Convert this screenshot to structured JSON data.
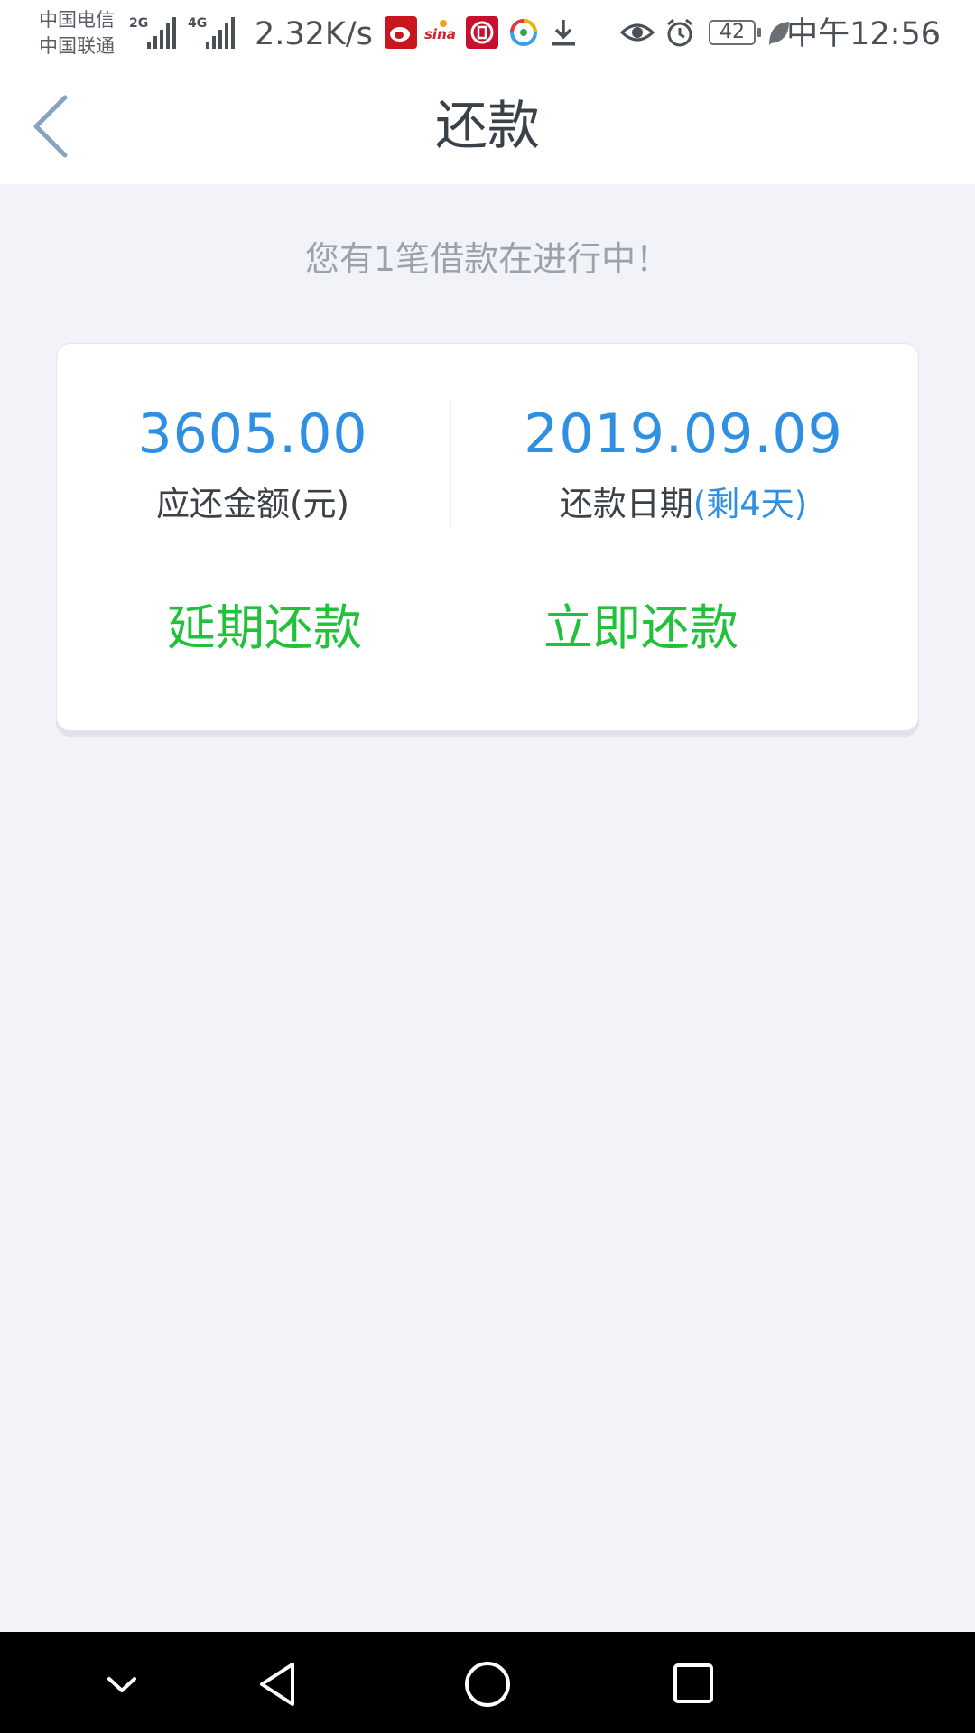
{
  "status_bar": {
    "carrier_1": "中国电信",
    "carrier_2": "中国联通",
    "network_1": "2G",
    "network_2": "4G",
    "net_speed": "2.32K/s",
    "more": "···",
    "battery": "42",
    "time": "中午12:56"
  },
  "header": {
    "title": "还款"
  },
  "notice": "您有1笔借款在进行中！",
  "loan": {
    "amount": "3605.00",
    "amount_label": "应还金额(元)",
    "due_date": "2019.09.09",
    "due_date_label": "还款日期",
    "remaining": "(剩4天)"
  },
  "actions": {
    "defer_label": "延期还款",
    "pay_now_label": "立即还款"
  },
  "colors": {
    "accent_blue": "#2f8fe3",
    "action_green": "#21c13a",
    "background": "#f1f3f8"
  },
  "icons": {
    "back": "chevron-left-icon",
    "nav_down": "chevron-down-icon",
    "nav_back": "triangle-back-icon",
    "nav_home": "circle-home-icon",
    "nav_recent": "square-recent-icon"
  }
}
